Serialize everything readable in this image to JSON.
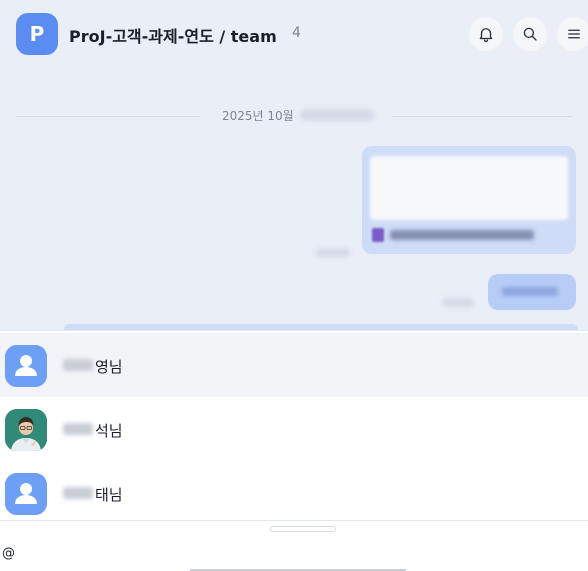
{
  "header": {
    "avatar_letter": "P",
    "title": "ProJ-고객-과제-연도 / team",
    "member_count": "4",
    "icons": [
      "bell-icon",
      "search-icon",
      "menu-icon"
    ]
  },
  "chat": {
    "date_label": "2025년 10월"
  },
  "mentions": [
    {
      "name_suffix": "영님",
      "avatar": "default-person-icon",
      "active": true
    },
    {
      "name_suffix": "석님",
      "avatar": "profile-photo",
      "active": false
    },
    {
      "name_suffix": "태님",
      "avatar": "default-person-icon",
      "active": false
    }
  ],
  "composer": {
    "value": "@"
  },
  "colors": {
    "header_bg": "#e9eef7",
    "accent": "#5a8cf2",
    "bubble": "#cfdcf7"
  }
}
